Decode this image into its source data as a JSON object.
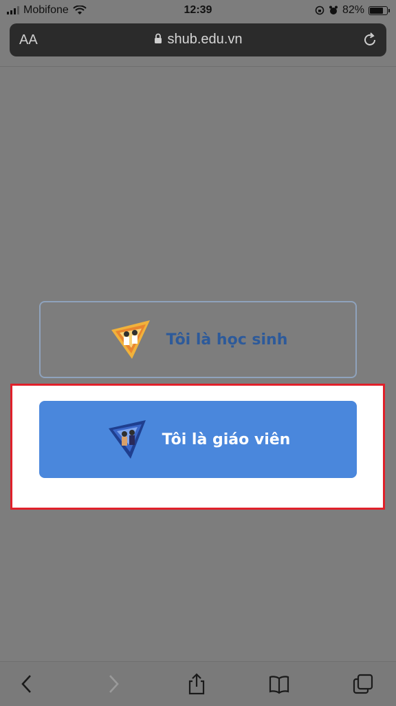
{
  "status_bar": {
    "carrier": "Mobifone",
    "time": "12:39",
    "battery": "82%",
    "battery_level": 0.82
  },
  "browser": {
    "text_size_label": "AA",
    "url": "shub.edu.vn"
  },
  "roles": {
    "student_label": "Tôi là học sinh",
    "teacher_label": "Tôi là giáo viên"
  },
  "colors": {
    "teacher_button": "#4a87dc",
    "student_text": "#2d5a9a",
    "highlight_border": "#e0202a"
  },
  "toolbar": {
    "icons": [
      "back-icon",
      "forward-icon",
      "share-icon",
      "bookmarks-icon",
      "tabs-icon"
    ]
  }
}
